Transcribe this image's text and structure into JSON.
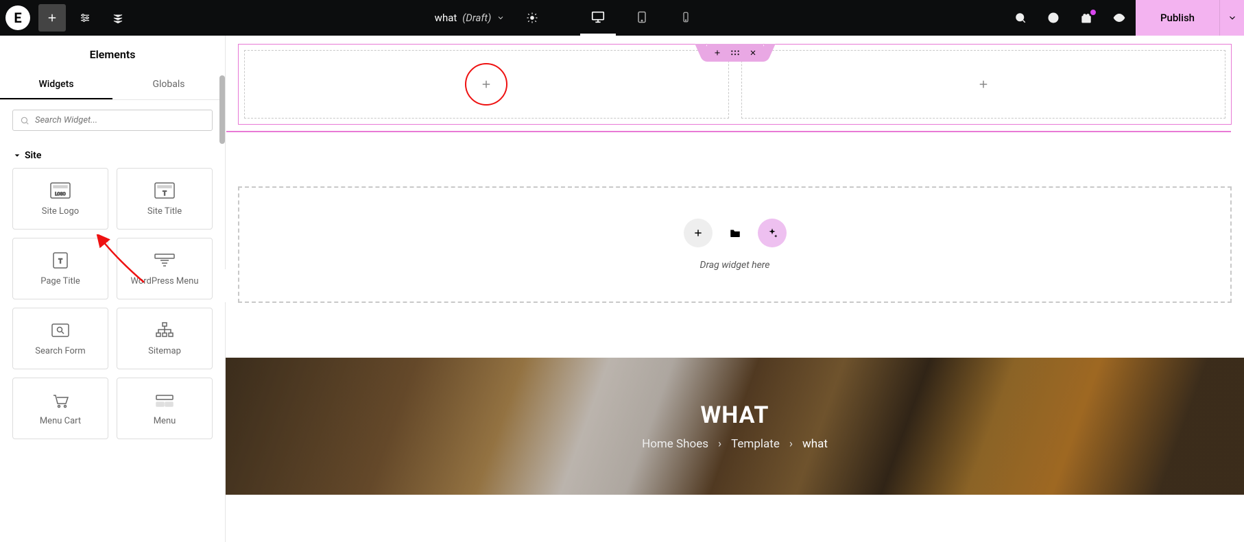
{
  "topbar": {
    "doc_name": "what",
    "doc_status": "(Draft)",
    "publish_label": "Publish"
  },
  "sidebar": {
    "title": "Elements",
    "tabs": {
      "widgets": "Widgets",
      "globals": "Globals"
    },
    "search_placeholder": "Search Widget...",
    "category": "Site",
    "widgets": [
      {
        "label": "Site Logo"
      },
      {
        "label": "Site Title"
      },
      {
        "label": "Page Title"
      },
      {
        "label": "WordPress Menu"
      },
      {
        "label": "Search Form"
      },
      {
        "label": "Sitemap"
      },
      {
        "label": "Menu Cart"
      },
      {
        "label": "Menu"
      }
    ]
  },
  "canvas": {
    "drag_hint": "Drag widget here"
  },
  "hero": {
    "title": "WHAT",
    "breadcrumb": {
      "home": "Home Shoes",
      "mid": "Template",
      "current": "what",
      "sep": "›"
    }
  }
}
